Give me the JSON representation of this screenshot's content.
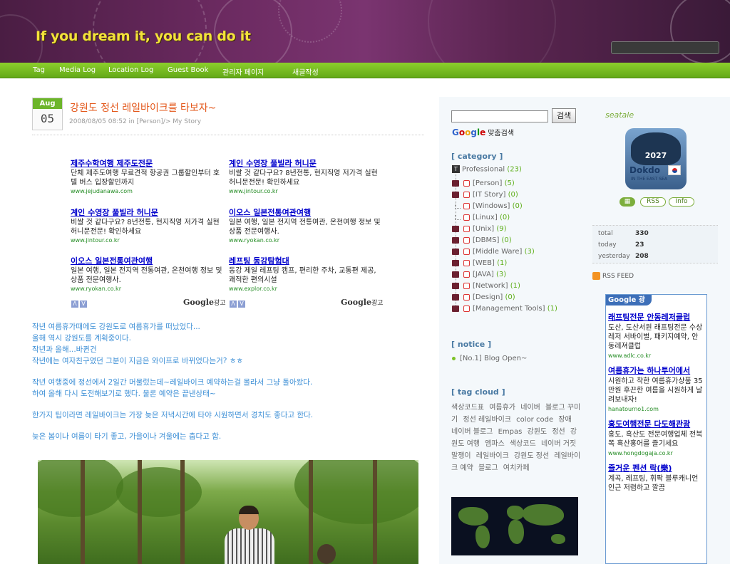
{
  "header": {
    "site_title": "If you dream it, you can do it"
  },
  "nav": {
    "items": [
      "Tag",
      "Media Log",
      "Location Log",
      "Guest Book",
      "관리자 페이지",
      "새글작성"
    ]
  },
  "post": {
    "month": "Aug",
    "day": "05",
    "title": "강원도 정선 레일바이크를 타보자~",
    "meta": "2008/08/05 08:52 in [Person]/> My Story",
    "body": [
      "작년 여름휴가때에도 강원도로 여름휴가를 떠났었다...",
      "올해 역시 강원도를 계획중이다.",
      "작년과 올해...바뀐건",
      "작년에는 여자친구였던 그분이 지금은 와이프로 바뀌었다는거? ㅎㅎ",
      "작년 여행중에 정선에서 2일간 머물렀는데~레일바이크 예약하는걸 몰라서 그냥 돌아왔다.",
      "하여 올해 다시 도전해보기로 했다. 물론 예약은 끝낸상태~",
      "한가지 팁이라면 레일바이크는 가장 늦은 저녁시간에 타야 시원하면서 경치도 좋다고 한다.",
      "늦은 봄이나 여름이 타기 좋고, 가을이나 겨울에는 춥다고 함."
    ]
  },
  "ads": {
    "google_label": "Google",
    "google_suffix": "광고",
    "nav_prev": "Λ",
    "nav_next": "V",
    "items": [
      {
        "title": "제주수학여행 제주도전문",
        "body": "단체 제주도여행 무료견적 항공권 그룹할인부터 호텔 버스 입장할인까지",
        "url": "www.jejudanawa.com"
      },
      {
        "title": "계인 수영장 풀빌라 허니문",
        "body": "비쌀 것 같다구요? 8년전통, 현지직영 저가격 실현 허니문전문! 확인하세요",
        "url": "www.jintour.co.kr"
      },
      {
        "title": "계인 수영장 풀빌라 허니문",
        "body": "비쌀 것 같다구요? 8년전통, 현지직영 저가격 실현 허니문전문! 확인하세요",
        "url": "www.jintour.co.kr"
      },
      {
        "title": "이오스 일본전통여관여행",
        "body": "일본 여행, 일본 전지역 전통여관, 온천여행 정보 및 상품 전문여행사.",
        "url": "www.ryokan.co.kr"
      },
      {
        "title": "이오스 일본전통여관여행",
        "body": "일본 여행, 일본 전지역 전통여관, 온천여행 정보 및 상품 전문여행사.",
        "url": "www.ryokan.co.kr"
      },
      {
        "title": "레프팅 동강탐험대",
        "body": "동강 제일 레프팅 캠프, 편리한 주차, 교통편 제공, 쾌적한 편의시설",
        "url": "www.explor.co.kr"
      }
    ]
  },
  "sidebar": {
    "search_button": "검색",
    "google_search_suffix": "맞춤검색",
    "category_heading": "[ category ]",
    "category_root": "Professional",
    "category_root_count": "(23)",
    "categories": [
      {
        "name": "[Person]",
        "count": "(5)"
      },
      {
        "name": "[IT Story]",
        "count": "(0)"
      },
      {
        "name": "[Windows]",
        "count": "(0)"
      },
      {
        "name": "[Linux]",
        "count": "(0)"
      },
      {
        "name": "[Unix]",
        "count": "(9)"
      },
      {
        "name": "[DBMS]",
        "count": "(0)"
      },
      {
        "name": "[Middle Ware]",
        "count": "(3)"
      },
      {
        "name": "[WEB]",
        "count": "(1)"
      },
      {
        "name": "[JAVA]",
        "count": "(3)"
      },
      {
        "name": "[Network]",
        "count": "(1)"
      },
      {
        "name": "[Design]",
        "count": "(0)"
      },
      {
        "name": "[Management Tools]",
        "count": "(1)"
      }
    ],
    "notice_heading": "[ notice ]",
    "notice_item": "[No.1] Blog Open~",
    "tagcloud_heading": "[ tag cloud ]",
    "tags": [
      "색상코드표",
      "여름휴가",
      "네이버",
      "블로그 꾸미기",
      "정선 레일바이크",
      "color code",
      "장애",
      "네이버 블로그",
      "Empas",
      "강원도",
      "정선",
      "강원도 여행",
      "엠파스",
      "색상코드",
      "네이버 거짓말쟁이",
      "레일바이크",
      "강원도 정선",
      "레일바이크 예약",
      "블로그",
      "여치카페"
    ],
    "seatale": "seatale",
    "dokdo_year": "2027",
    "dokdo_name": "Dokdo",
    "dokdo_sub": "IN THE EAST SEA",
    "btn_rss": "RSS",
    "btn_info": "Info",
    "stats": {
      "total_label": "total",
      "total": "330",
      "today_label": "today",
      "today": "23",
      "yesterday_label": "yesterday",
      "yesterday": "208"
    },
    "rss_feed": "RSS FEED",
    "gads_header": "Google 광고",
    "gads": [
      {
        "title": "래프팅전문 안동레저클럽",
        "body": "도산, 도산서원 래프팅전문 수상레저 서바이벌, 패키지예약, 안동레져클럽",
        "url": "www.adlc.co.kr"
      },
      {
        "title": "여름휴가는 하나투어에서",
        "body": "시원하고 착한 여름휴가상품 35만원 후끈한 여름을 시원하게 날려보내자!",
        "url": "hanatourno1.com"
      },
      {
        "title": "홍도여행전문 다도해관광",
        "body": "홍도, 흑산도 전문여행업체 전북쪽 흑산홍어를 즐기세요",
        "url": "www.hongdogaja.co.kr"
      },
      {
        "title": "즐거운 펜션 락(樂)",
        "body": "계곡, 레프팅, 휘팍 블루캐니언 인근 저렴하고 깔끔",
        "url": ""
      }
    ]
  }
}
